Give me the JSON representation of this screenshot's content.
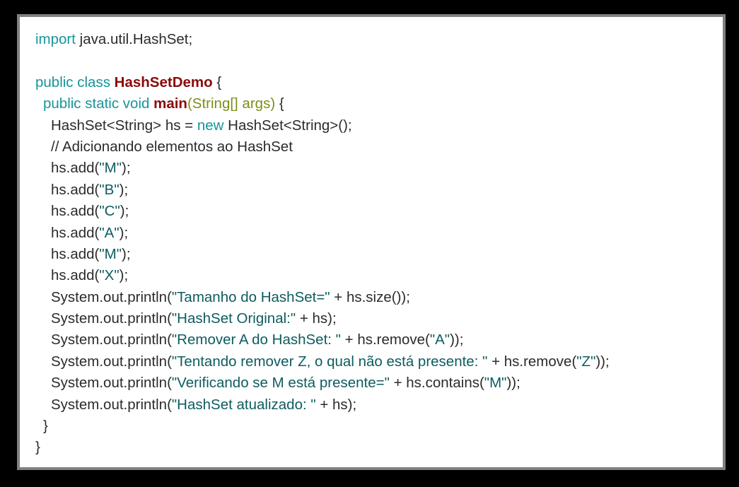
{
  "code": {
    "language": "java",
    "lines": [
      {
        "parts": [
          "import",
          " java.util.HashSet;"
        ]
      },
      {
        "parts": []
      },
      {
        "parts": [
          "public class ",
          "HashSetDemo",
          " {"
        ]
      },
      {
        "parts": [
          "public static void ",
          "main",
          "(String[] args)",
          " {"
        ]
      },
      {
        "parts": [
          "HashSet<String> hs = ",
          "new",
          " HashSet<String>();"
        ]
      },
      {
        "parts": [
          "// Adicionando elementos ao HashSet"
        ]
      },
      {
        "parts": [
          "hs.add(",
          "\"M\"",
          ");"
        ]
      },
      {
        "parts": [
          "hs.add(",
          "\"B\"",
          ");"
        ]
      },
      {
        "parts": [
          "hs.add(",
          "\"C\"",
          ");"
        ]
      },
      {
        "parts": [
          "hs.add(",
          "\"A\"",
          ");"
        ]
      },
      {
        "parts": [
          "hs.add(",
          "\"M\"",
          ");"
        ]
      },
      {
        "parts": [
          "hs.add(",
          "\"X\"",
          ");"
        ]
      },
      {
        "parts": [
          "System.out.println(",
          "\"Tamanho do HashSet=\"",
          " + hs.size());"
        ]
      },
      {
        "parts": [
          "System.out.println(",
          "\"HashSet Original:\"",
          " + hs);"
        ]
      },
      {
        "parts": [
          "System.out.println(",
          "\"Remover A do HashSet: \"",
          " + hs.remove(",
          "\"A\"",
          "));"
        ]
      },
      {
        "parts": [
          "System.out.println(",
          "\"Tentando remover Z, o qual não está presente: \"",
          " + hs.remove(",
          "\"Z\"",
          "));"
        ]
      },
      {
        "parts": [
          "System.out.println(",
          "\"Verificando se M está presente=\"",
          " + hs.contains(",
          "\"M\"",
          "));"
        ]
      },
      {
        "parts": [
          "System.out.println(",
          "\"HashSet atualizado: \"",
          " + hs);"
        ]
      },
      {
        "parts": [
          "}"
        ]
      },
      {
        "parts": [
          "}"
        ]
      }
    ]
  },
  "colors": {
    "background": "#000000",
    "frame": "#808080",
    "panel": "#ffffff",
    "keyword": "#16959a",
    "class_name": "#8b0a0a",
    "string_literal": "#0e5c5f",
    "parameter_type": "#7a8f1a",
    "plain_text": "#2b2b2b"
  }
}
